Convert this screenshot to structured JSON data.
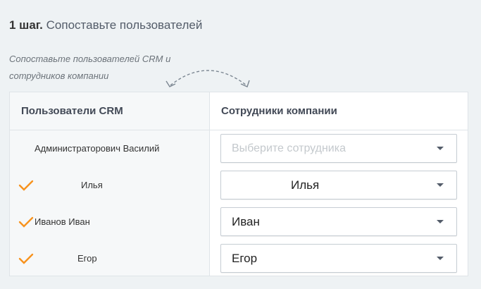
{
  "step": {
    "number": "1 шаг.",
    "title": "Сопоставьте пользователей"
  },
  "hint": {
    "line1": "Сопоставьте пользователей CRM и",
    "line2": "сотрудников компании"
  },
  "table": {
    "left_header": "Пользователи CRM",
    "right_header": "Сотрудники компании",
    "rows": [
      {
        "user": "Администраторович Василий",
        "matched": false,
        "employee": "",
        "placeholder": "Выберите сотрудника"
      },
      {
        "user": "Илья",
        "matched": true,
        "employee": "Илья",
        "placeholder": ""
      },
      {
        "user": "Иванов Иван",
        "matched": true,
        "employee": "Иван",
        "placeholder": ""
      },
      {
        "user": "Егор",
        "matched": true,
        "employee": "Егор",
        "placeholder": ""
      }
    ]
  },
  "colors": {
    "check": "#f7931e",
    "border": "#dfe4e8",
    "left_bg": "#f6f8f9"
  },
  "icons": {
    "check": "check-icon",
    "caret": "chevron-down-icon",
    "swap": "swap-arrow-icon"
  }
}
